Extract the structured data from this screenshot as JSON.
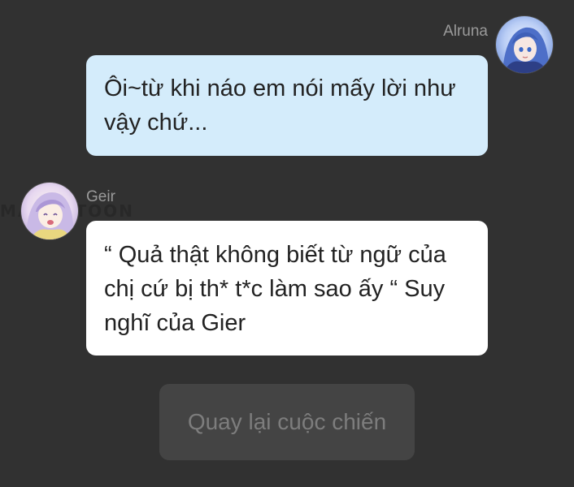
{
  "messages": [
    {
      "sender": "Alruna",
      "side": "right",
      "bubble_color": "#d4ecfb",
      "text": "Ôi~từ khi náo em nói mấy lời như vậy chứ...",
      "avatar": "girl-avatar-blue-hair"
    },
    {
      "sender": "Geir",
      "side": "left",
      "bubble_color": "#ffffff",
      "text": "“ Quả thật không biết từ ngữ của chị cứ bị th* t*c làm sao ấy “ Suy nghĩ của Gier",
      "avatar": "girl-avatar-lavender-hair"
    }
  ],
  "action_button": {
    "label": "Quay lại cuộc chiến"
  },
  "watermark": "MANGATOON",
  "colors": {
    "background": "#313131",
    "button_bg": "#444444",
    "button_text": "#7d7d7d"
  }
}
